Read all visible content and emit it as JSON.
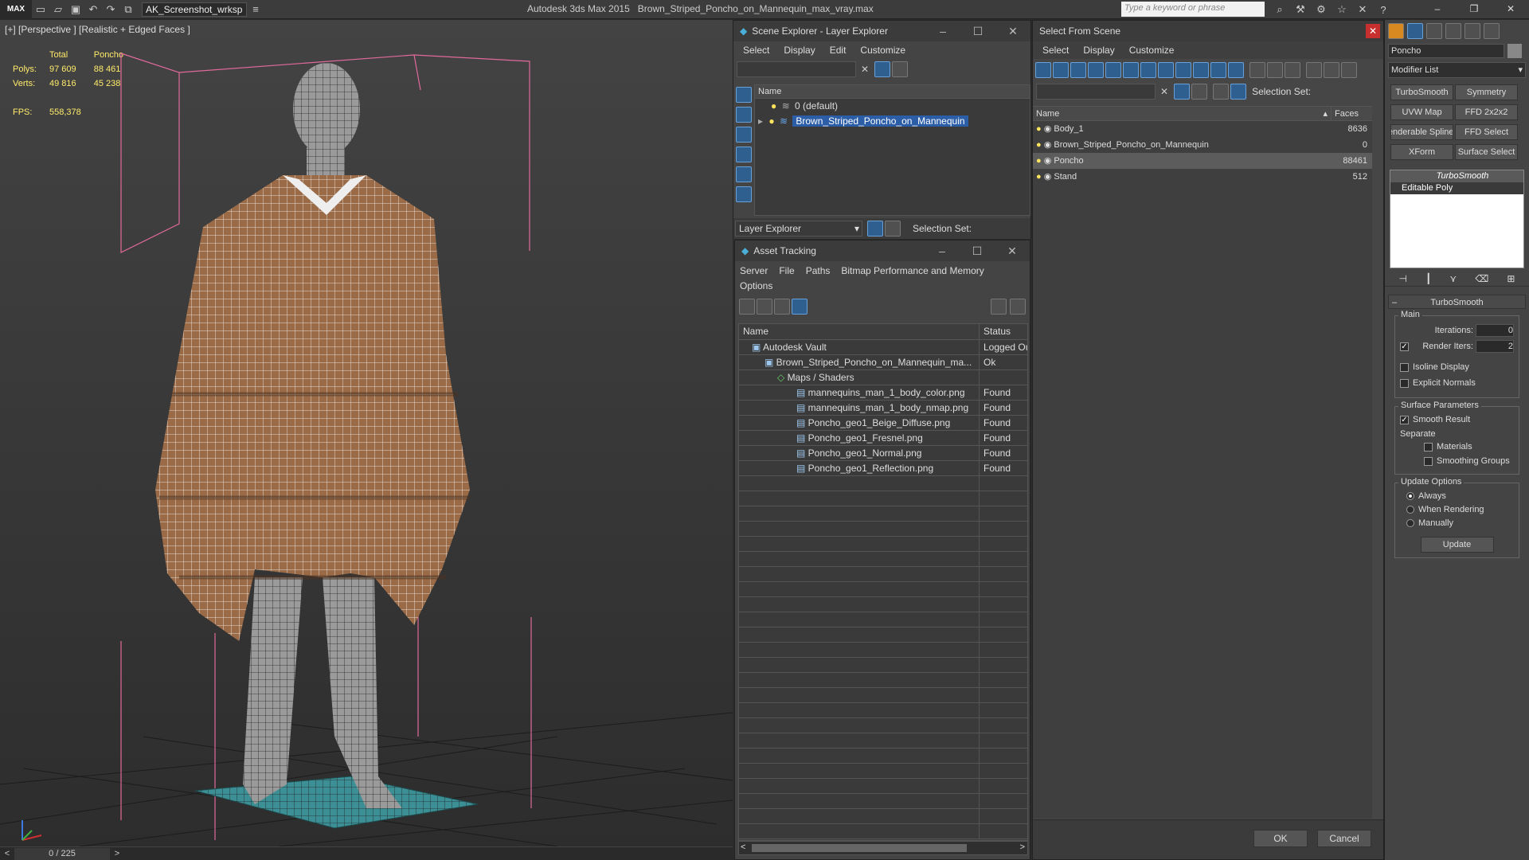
{
  "topbar": {
    "logo": "MAX",
    "workspace": "AK_Screenshot_wrksp",
    "app_title": "Autodesk 3ds Max  2015",
    "file_title": "Brown_Striped_Poncho_on_Mannequin_max_vray.max",
    "search_placeholder": "Type a keyword or phrase"
  },
  "viewport": {
    "label": "[+] [Perspective ] [Realistic + Edged Faces ]",
    "stats": {
      "col_total": "Total",
      "col_object": "Poncho",
      "polys_label": "Polys:",
      "polys_total": "97 609",
      "polys_object": "88 461",
      "verts_label": "Verts:",
      "verts_total": "49 816",
      "verts_object": "45 238",
      "fps_label": "FPS:",
      "fps_value": "558,378"
    },
    "timeline": "0 / 225"
  },
  "scene_explorer": {
    "title": "Scene Explorer - Layer Explorer",
    "menu": [
      "Select",
      "Display",
      "Edit",
      "Customize"
    ],
    "column_name": "Name",
    "layers": [
      {
        "name": "0 (default)",
        "selected": false
      },
      {
        "name": "Brown_Striped_Poncho_on_Mannequin",
        "selected": true
      }
    ],
    "footer_dropdown": "Layer Explorer",
    "footer_selection_set": "Selection Set:"
  },
  "asset_tracking": {
    "title": "Asset Tracking",
    "menu": [
      "Server",
      "File",
      "Paths",
      "Bitmap Performance and Memory",
      "Options"
    ],
    "columns": {
      "name": "Name",
      "status": "Status"
    },
    "rows": [
      {
        "name": "Autodesk Vault",
        "status": "Logged Out",
        "indent": 0
      },
      {
        "name": "Brown_Striped_Poncho_on_Mannequin_ma...",
        "status": "Ok",
        "indent": 1
      },
      {
        "name": "Maps / Shaders",
        "status": "",
        "indent": 2
      },
      {
        "name": "mannequins_man_1_body_color.png",
        "status": "Found",
        "indent": 3
      },
      {
        "name": "mannequins_man_1_body_nmap.png",
        "status": "Found",
        "indent": 3
      },
      {
        "name": "Poncho_geo1_Beige_Diffuse.png",
        "status": "Found",
        "indent": 3
      },
      {
        "name": "Poncho_geo1_Fresnel.png",
        "status": "Found",
        "indent": 3
      },
      {
        "name": "Poncho_geo1_Normal.png",
        "status": "Found",
        "indent": 3
      },
      {
        "name": "Poncho_geo1_Reflection.png",
        "status": "Found",
        "indent": 3
      }
    ]
  },
  "select_from_scene": {
    "title": "Select From Scene",
    "menu": [
      "Select",
      "Display",
      "Customize"
    ],
    "selection_set": "Selection Set:",
    "columns": {
      "name": "Name",
      "faces": "Faces"
    },
    "objects": [
      {
        "name": "Body_1",
        "faces": "8636",
        "selected": false
      },
      {
        "name": "Brown_Striped_Poncho_on_Mannequin",
        "faces": "0",
        "selected": false
      },
      {
        "name": "Poncho",
        "faces": "88461",
        "selected": true
      },
      {
        "name": "Stand",
        "faces": "512",
        "selected": false
      }
    ],
    "ok": "OK",
    "cancel": "Cancel"
  },
  "command_panel": {
    "object_name": "Poncho",
    "modifier_list": "Modifier List",
    "buttons": [
      "TurboSmooth",
      "Symmetry",
      "UVW Map",
      "FFD 2x2x2",
      "Renderable Spline",
      "FFD Select",
      "XForm",
      "Surface Select"
    ],
    "stack": [
      "TurboSmooth",
      "Editable Poly"
    ],
    "rollout_title": "TurboSmooth",
    "main_label": "Main",
    "iterations_label": "Iterations:",
    "iterations_value": "0",
    "render_iters_label": "Render Iters:",
    "render_iters_value": "2",
    "isoline": "Isoline Display",
    "explicit_normals": "Explicit Normals",
    "surface_params": "Surface Parameters",
    "smooth_result": "Smooth Result",
    "separate": "Separate",
    "materials": "Materials",
    "smoothing_groups": "Smoothing Groups",
    "update_options": "Update Options",
    "always": "Always",
    "when_rendering": "When Rendering",
    "manually": "Manually",
    "update_btn": "Update"
  }
}
